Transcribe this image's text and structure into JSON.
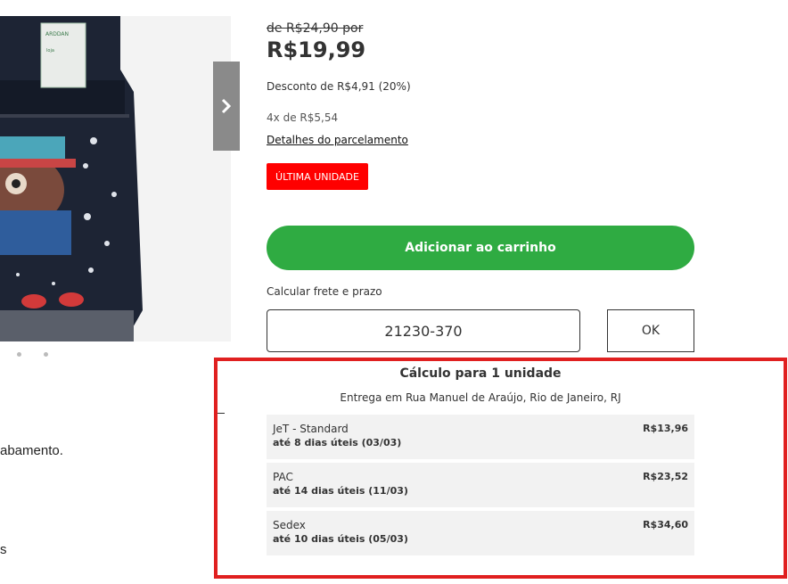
{
  "product": {
    "old_price": "de R$24,90 por",
    "price": "R$19,99",
    "discount": "Desconto de R$4,91 (20%)",
    "installments_count": "4x",
    "installments_de": "de",
    "installments_value": "R$5,54",
    "installment_link": "Detalhes do parcelamento",
    "badge": "ÚLTIMA UNIDADE",
    "add_to_cart": "Adicionar ao carrinho"
  },
  "shipping": {
    "label": "Calcular frete e prazo",
    "cep_value": "21230-370",
    "ok_label": "OK",
    "result_title": "Cálculo para 1 unidade",
    "address": "Entrega em Rua Manuel de Araújo, Rio de Janeiro, RJ",
    "options": [
      {
        "name": "JeT - Standard",
        "time": "até 8 dias úteis (03/03)",
        "price": "R$13,96"
      },
      {
        "name": "PAC",
        "time": "até 14 dias úteis (11/03)",
        "price": "R$23,52"
      },
      {
        "name": "Sedex",
        "time": "até 10 dias úteis (05/03)",
        "price": "R$34,60"
      }
    ]
  },
  "description": {
    "fragment_1": "abamento.",
    "fragment_2": "s"
  },
  "colors": {
    "accent_green": "#2fab42",
    "badge_red": "#ff0000",
    "highlight_red": "#e02020"
  }
}
